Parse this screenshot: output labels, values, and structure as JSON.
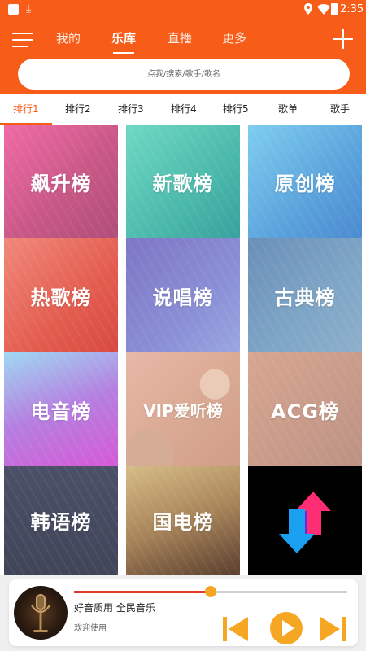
{
  "status_bar": {
    "time": "2:35",
    "download_glyph": "⤓"
  },
  "header": {
    "tabs": [
      {
        "label": "我的",
        "active": false
      },
      {
        "label": "乐库",
        "active": true
      },
      {
        "label": "直播",
        "active": false
      },
      {
        "label": "更多",
        "active": false
      }
    ],
    "search_placeholder": "点我/搜索/歌手/歌名"
  },
  "categories": [
    {
      "label": "排行1",
      "active": true
    },
    {
      "label": "排行2",
      "active": false
    },
    {
      "label": "排行3",
      "active": false
    },
    {
      "label": "排行4",
      "active": false
    },
    {
      "label": "排行5",
      "active": false
    },
    {
      "label": "歌单",
      "active": false
    },
    {
      "label": "歌手",
      "active": false
    }
  ],
  "charts": [
    {
      "label": "飙升榜"
    },
    {
      "label": "新歌榜"
    },
    {
      "label": "原创榜"
    },
    {
      "label": "热歌榜"
    },
    {
      "label": "说唱榜"
    },
    {
      "label": "古典榜"
    },
    {
      "label": "电音榜"
    },
    {
      "label": "VIP爱听榜"
    },
    {
      "label": "ACG榜"
    },
    {
      "label": "韩语榜"
    },
    {
      "label": "国电榜"
    },
    {
      "label": ""
    }
  ],
  "player": {
    "song_title": "好音质用 全民音乐",
    "subtitle": "欢迎使用",
    "progress_percent": 50
  },
  "colors": {
    "accent": "#f75d19",
    "player_buttons": "#f5a623"
  }
}
